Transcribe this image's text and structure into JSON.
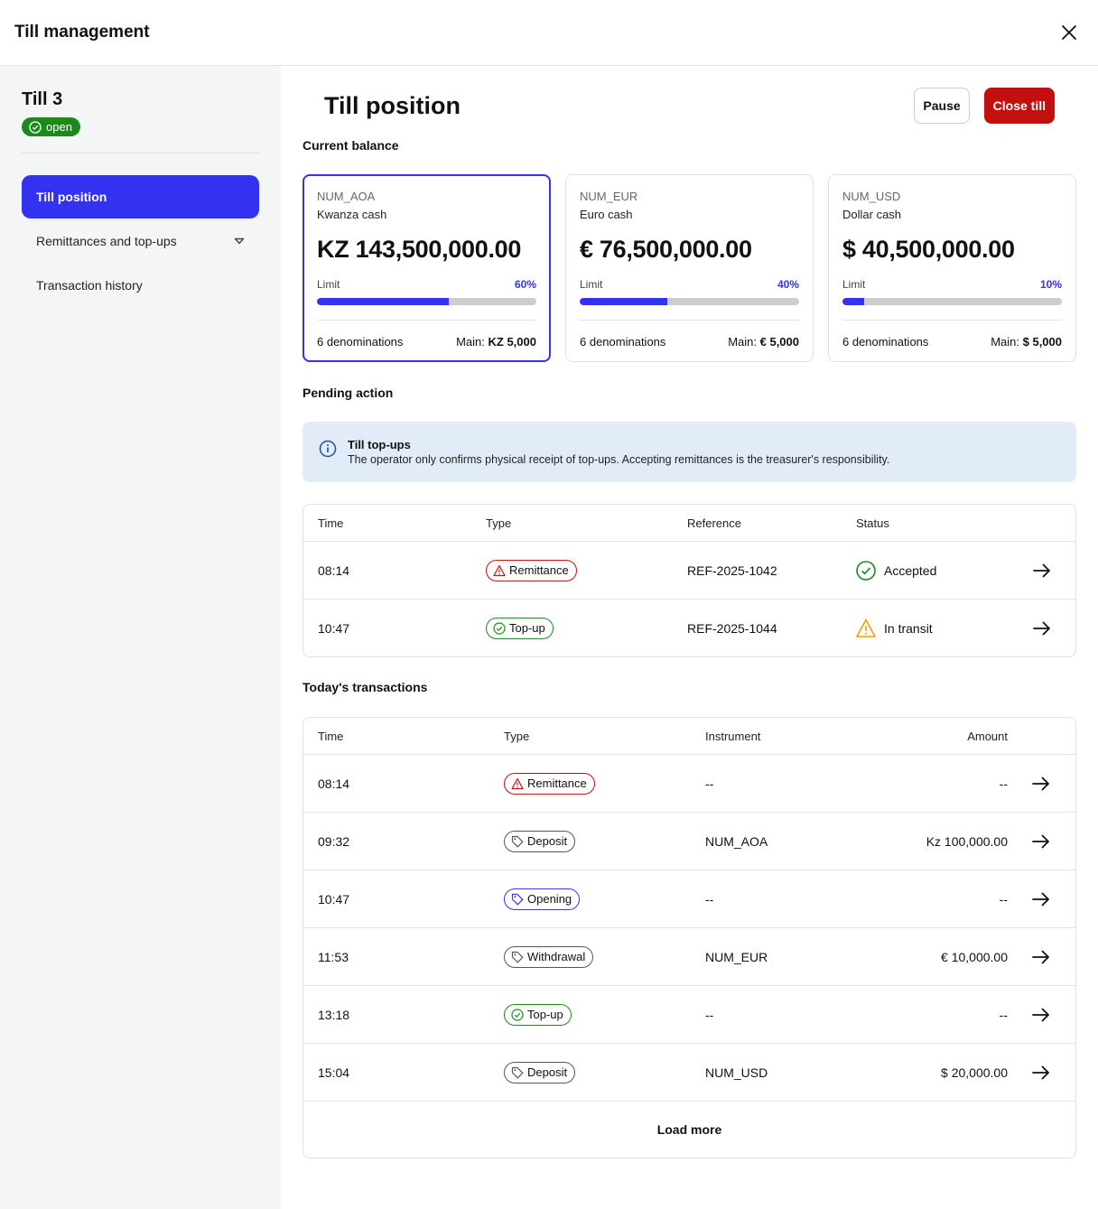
{
  "header": {
    "title": "Till management"
  },
  "sidebar": {
    "till_name": "Till 3",
    "status": "open",
    "nav": [
      {
        "label": "Till position",
        "active": true
      },
      {
        "label": "Remittances and top-ups",
        "expandable": true
      },
      {
        "label": "Transaction history"
      }
    ]
  },
  "main": {
    "title": "Till position",
    "pause_label": "Pause",
    "close_label": "Close till",
    "current_balance_label": "Current balance",
    "cards": [
      {
        "code": "NUM_AOA",
        "name": "Kwanza cash",
        "amount": "KZ 143,500,000.00",
        "limit_label": "Limit",
        "limit_pct": "60%",
        "limit_value": 0.6,
        "denominations": "6 denominations",
        "main_label": "Main:",
        "main_value": "KZ 5,000"
      },
      {
        "code": "NUM_EUR",
        "name": "Euro cash",
        "amount": "€ 76,500,000.00",
        "limit_label": "Limit",
        "limit_pct": "40%",
        "limit_value": 0.4,
        "denominations": "6 denominations",
        "main_label": "Main:",
        "main_value": "€ 5,000"
      },
      {
        "code": "NUM_USD",
        "name": "Dollar cash",
        "amount": "$ 40,500,000.00",
        "limit_label": "Limit",
        "limit_pct": "10%",
        "limit_value": 0.1,
        "denominations": "6 denominations",
        "main_label": "Main:",
        "main_value": "$ 5,000"
      }
    ],
    "pending_label": "Pending action",
    "info": {
      "title": "Till top-ups",
      "text": "The operator only confirms physical receipt of top-ups. Accepting remittances is the treasurer's responsibility."
    },
    "pending_table": {
      "headers": [
        "Time",
        "Type",
        "Reference",
        "Status"
      ],
      "rows": [
        {
          "time": "08:14",
          "type": "Remittance",
          "reference": "REF-2025-1042",
          "status": "Accepted"
        },
        {
          "time": "10:47",
          "type": "Top-up",
          "reference": "REF-2025-1044",
          "status": "In transit"
        }
      ]
    },
    "today_label": "Today's transactions",
    "today_table": {
      "headers": [
        "Time",
        "Type",
        "Instrument",
        "Amount"
      ],
      "rows": [
        {
          "time": "08:14",
          "type": "Remittance",
          "instrument": "--",
          "amount": "--"
        },
        {
          "time": "09:32",
          "type": "Deposit",
          "instrument": "NUM_AOA",
          "amount": "Kz 100,000.00"
        },
        {
          "time": "10:47",
          "type": "Opening",
          "instrument": "--",
          "amount": "--"
        },
        {
          "time": "11:53",
          "type": "Withdrawal",
          "instrument": "NUM_EUR",
          "amount": "€ 10,000.00"
        },
        {
          "time": "13:18",
          "type": "Top-up",
          "instrument": "--",
          "amount": "--"
        },
        {
          "time": "15:04",
          "type": "Deposit",
          "instrument": "NUM_USD",
          "amount": "$ 20,000.00"
        }
      ],
      "load_more": "Load more"
    },
    "colors": {
      "accent": "#3232f0",
      "danger": "#c40f0f",
      "success": "#1b8a1b",
      "warning": "#e8a100",
      "info_bg": "#e2ecf8"
    }
  }
}
